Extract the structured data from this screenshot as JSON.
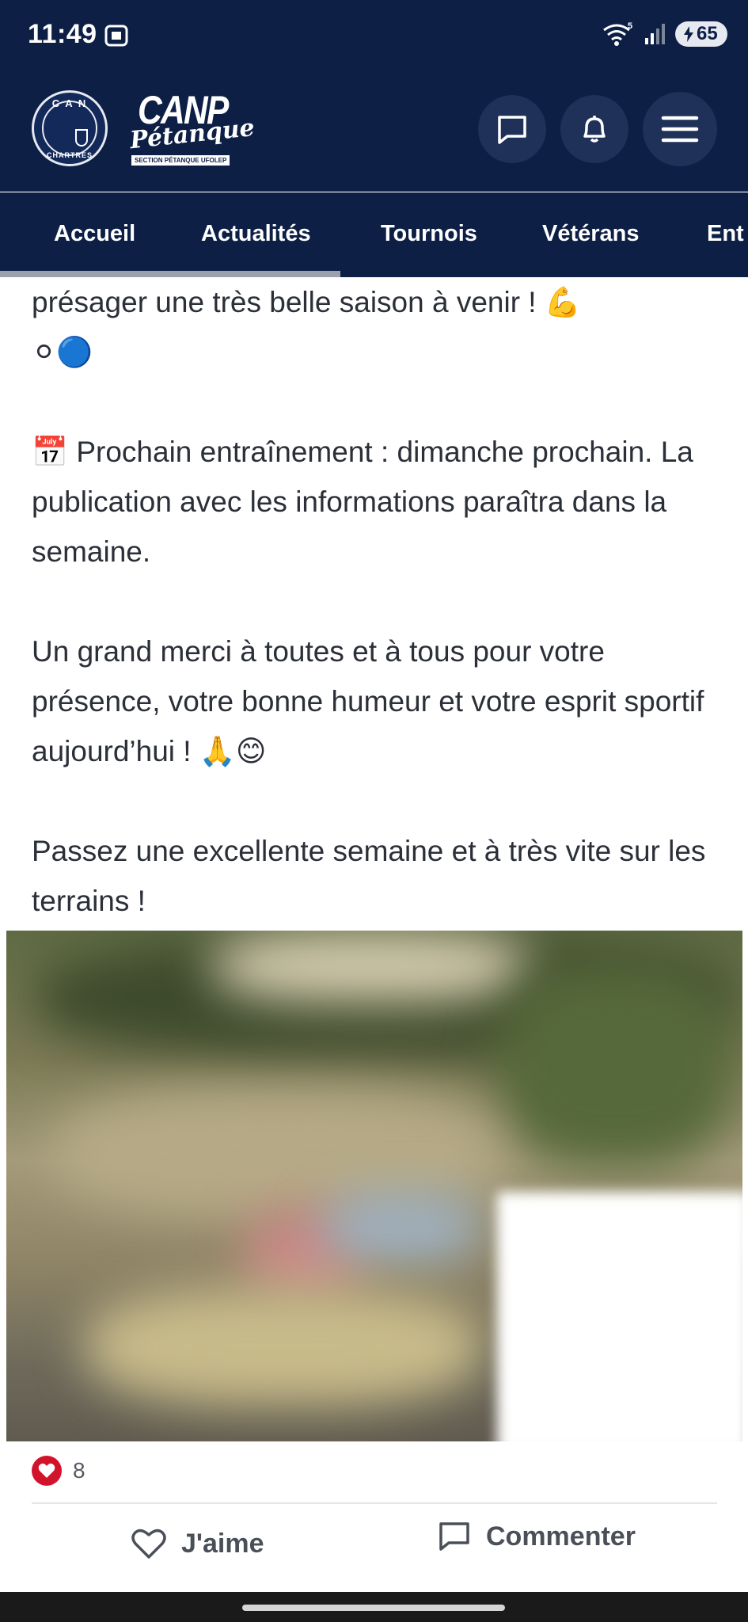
{
  "status_bar": {
    "time": "11:49",
    "wifi_badge": "5",
    "battery": "65",
    "icons": [
      "screenshot-icon",
      "wifi-icon",
      "signal-icon",
      "battery-charging-icon"
    ]
  },
  "header": {
    "badge_top": "C A N",
    "badge_bottom": "CHARTRES",
    "logo_main": "CANP",
    "logo_script": "Pétanque",
    "logo_sub": "SECTION PÉTANQUE UFOLEP",
    "icons": [
      "chat-icon",
      "bell-icon",
      "menu-icon"
    ]
  },
  "nav": {
    "tabs": [
      "Accueil",
      "Actualités",
      "Tournois",
      "Vétérans",
      "Ent"
    ]
  },
  "post": {
    "line1": "présager une très belle saison à venir ! 💪",
    "line2": "⚪🔵",
    "training": "📅 Prochain entraînement : dimanche prochain. La publication avec les informations paraîtra dans la semaine.",
    "thanks": "Un grand merci à toutes et à tous pour votre présence, votre bonne humeur et votre esprit sportif aujourd’hui ! 🙏😊",
    "closing": "Passez une excellente semaine et à très vite sur les terrains !"
  },
  "reactions": {
    "count": "8"
  },
  "actions": {
    "like": "J'aime",
    "comment": "Commenter"
  },
  "colors": {
    "header_bg": "#0d1f45",
    "heart": "#d1142c",
    "text": "#2b2f38"
  }
}
